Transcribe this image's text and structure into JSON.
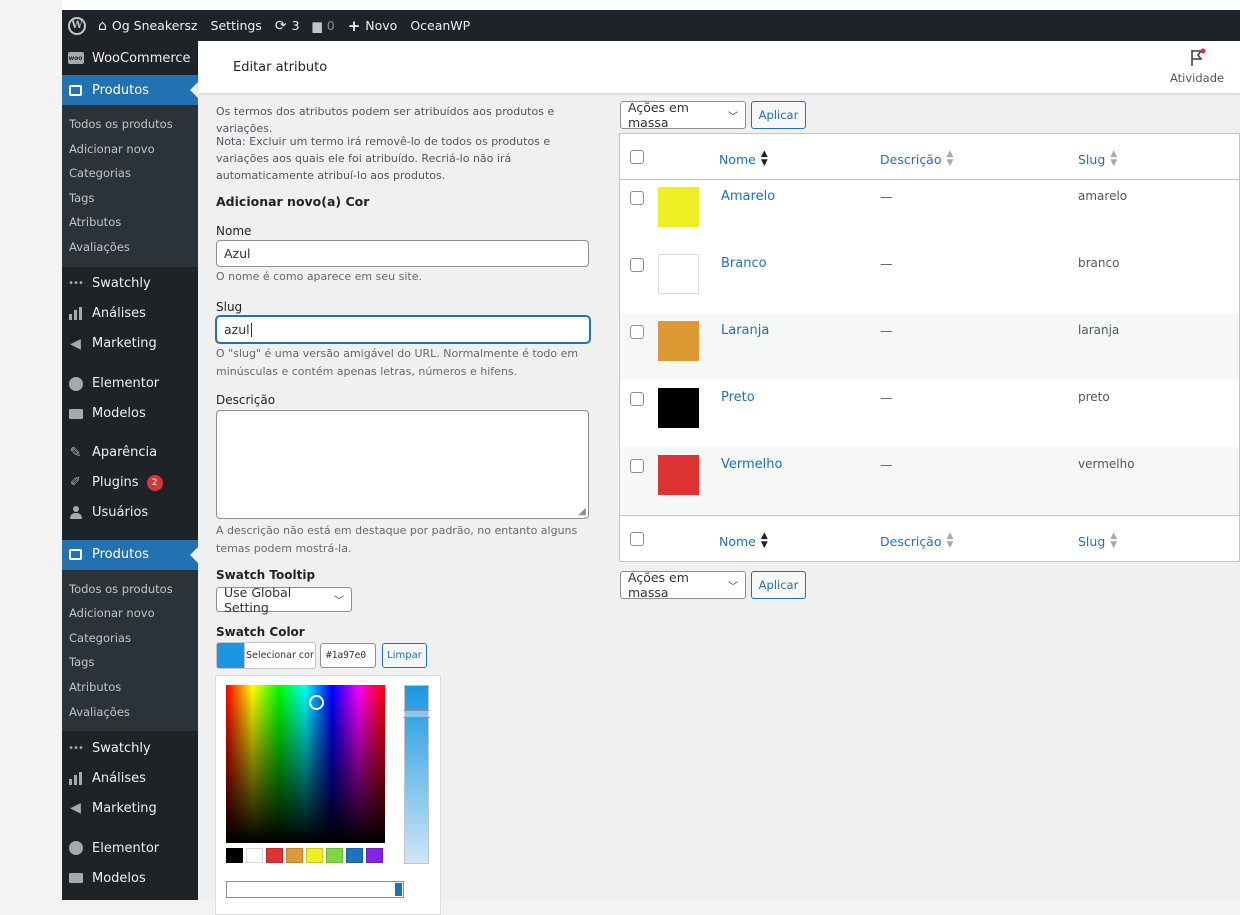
{
  "admin_bar": {
    "site_name": "Og Sneakersz",
    "settings": "Settings",
    "updates_count": "3",
    "comments_count": "0",
    "new_label": "Novo",
    "theme_label": "OceanWP"
  },
  "sidebar": {
    "woocommerce": "WooCommerce",
    "produtos": "Produtos",
    "submenu": [
      "Todos os produtos",
      "Adicionar novo",
      "Categorias",
      "Tags",
      "Atributos",
      "Avaliações"
    ],
    "swatchly": "Swatchly",
    "analises": "Análises",
    "marketing": "Marketing",
    "elementor": "Elementor",
    "modelos": "Modelos",
    "aparencia": "Aparência",
    "plugins": "Plugins",
    "plugins_badge": "2",
    "usuarios": "Usuários"
  },
  "header": {
    "title": "Editar atributo",
    "activity": "Atividade"
  },
  "form": {
    "intro": "Os termos dos atributos podem ser atribuídos aos produtos e variações.",
    "note": "Nota: Excluir um termo irá removê-lo de todos os produtos e variações aos quais ele foi atribuído. Recriá-lo não irá automaticamente atribuí-lo aos produtos.",
    "add_heading": "Adicionar novo(a) Cor",
    "name_label": "Nome",
    "name_value": "Azul",
    "name_help": "O nome é como aparece em seu site.",
    "slug_label": "Slug",
    "slug_value": "azul",
    "slug_help": "O \"slug\" é uma versão amigável do URL. Normalmente é todo em minúsculas e contém apenas letras, números e hifens.",
    "desc_label": "Descrição",
    "desc_help": "A descrição não está em destaque por padrão, no entanto alguns temas podem mostrá-la.",
    "tooltip_label": "Swatch Tooltip",
    "tooltip_value": "Use Global Setting",
    "color_label": "Swatch Color",
    "select_color": "Selecionar cor",
    "hex_value": "#1a97e0",
    "clear": "Limpar",
    "current_color": "#1a97e0",
    "palette": [
      "#000000",
      "#ffffff",
      "#dd3333",
      "#dd9933",
      "#eeee22",
      "#81d742",
      "#1e73be",
      "#8224e3"
    ]
  },
  "table": {
    "bulk_label": "Ações em massa",
    "apply": "Aplicar",
    "col_name": "Nome",
    "col_desc": "Descrição",
    "col_slug": "Slug",
    "rows": [
      {
        "name": "Amarelo",
        "desc": "—",
        "slug": "amarelo",
        "color": "#eeee22"
      },
      {
        "name": "Branco",
        "desc": "—",
        "slug": "branco",
        "color": "#ffffff"
      },
      {
        "name": "Laranja",
        "desc": "—",
        "slug": "laranja",
        "color": "#dd9933"
      },
      {
        "name": "Preto",
        "desc": "—",
        "slug": "preto",
        "color": "#000000"
      },
      {
        "name": "Vermelho",
        "desc": "—",
        "slug": "vermelho",
        "color": "#dd3333"
      }
    ]
  }
}
